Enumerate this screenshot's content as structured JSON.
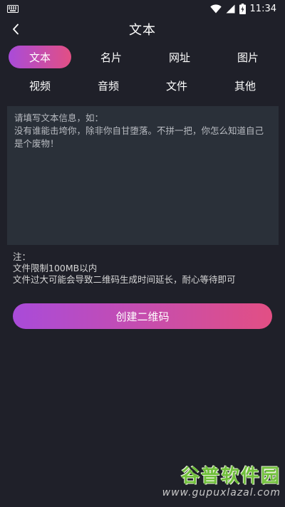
{
  "status_bar": {
    "time": "11:34"
  },
  "header": {
    "title": "文本"
  },
  "tabs": [
    {
      "label": "文本",
      "active": true
    },
    {
      "label": "名片"
    },
    {
      "label": "网址"
    },
    {
      "label": "图片"
    },
    {
      "label": "视频"
    },
    {
      "label": "音频"
    },
    {
      "label": "文件"
    },
    {
      "label": "其他"
    }
  ],
  "input": {
    "placeholder": "请填写文本信息，如：\n没有谁能击垮你，除非你自甘堕落。不拼一把，你怎么知道自己是个废物！",
    "value": ""
  },
  "notes": {
    "title": "注：",
    "line1": "文件限制100MB以内",
    "line2": "文件过大可能会导致二维码生成时间延长，耐心等待即可"
  },
  "create_button": {
    "label": "创建二维码"
  },
  "watermark": {
    "title": "谷普软件园",
    "url": "www.gupuxlazal.com"
  },
  "colors": {
    "background": "#1f2029",
    "accent_start": "#a94bd9",
    "accent_end": "#e24f84",
    "input_bg": "#2a3039"
  }
}
